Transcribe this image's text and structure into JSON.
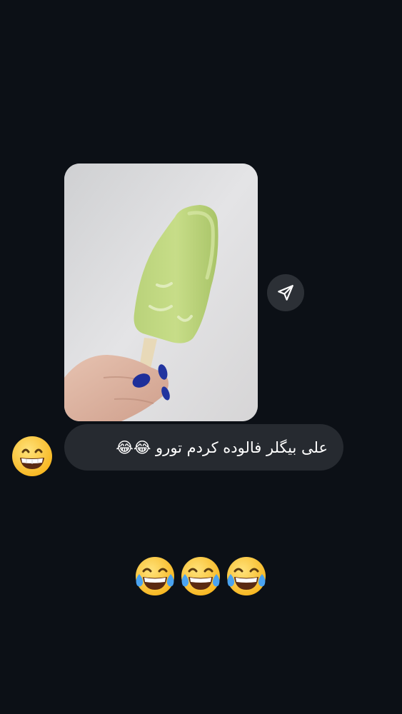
{
  "message": {
    "image_alt": "photo of a green popsicle held in a hand",
    "caption": "علی بیگلر فالوده کردم تورو 😂😂"
  },
  "share_button": {
    "icon": "send-icon"
  },
  "reaction": {
    "emoji": "😁"
  },
  "sent_emojis": [
    "😂",
    "😂",
    "😂"
  ],
  "colors": {
    "background": "#0c1016",
    "bubble": "#262a30",
    "share_button_bg": "#2c3036",
    "text": "#ffffff"
  }
}
